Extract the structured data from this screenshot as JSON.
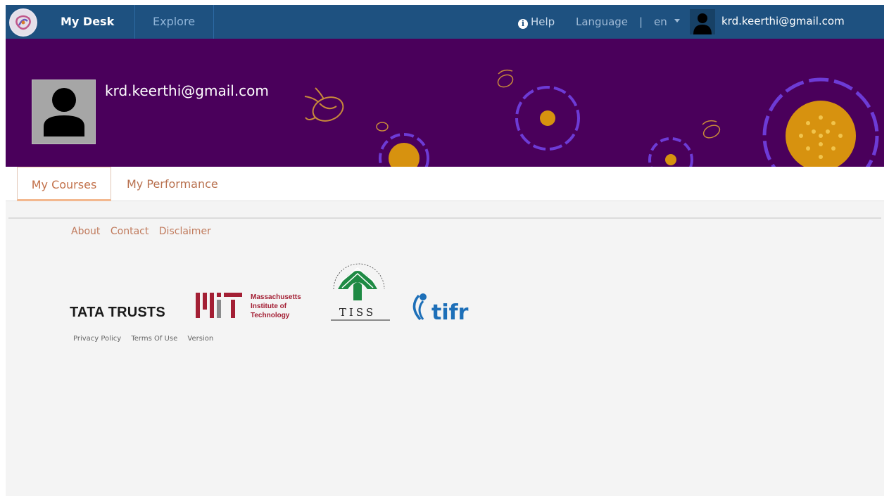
{
  "nav": {
    "my_desk": "My Desk",
    "explore": "Explore",
    "help": "Help",
    "help_icon": "info-icon",
    "language": "Language",
    "separator": "|",
    "language_value": "en",
    "user_email": "krd.keerthi@gmail.com"
  },
  "profile": {
    "name": "krd.keerthi@gmail.com"
  },
  "tabs": [
    {
      "label": "My Courses",
      "active": true
    },
    {
      "label": "My Performance",
      "active": false
    }
  ],
  "footer": {
    "links": [
      "About",
      "Contact",
      "Disclaimer"
    ],
    "partners": {
      "tata": "TATA TRUSTS",
      "mit_lines": [
        "Massachusetts",
        "Institute of",
        "Technology"
      ],
      "tiss": "TISS",
      "tifr": "tifr"
    },
    "small_links": [
      "Privacy Policy",
      "Terms Of Use",
      "Version"
    ]
  },
  "colors": {
    "navbar": "#1e5180",
    "banner": "#4a005b",
    "accent": "#c2714a",
    "mit_red": "#a31f34",
    "tifr_blue": "#1d6fb8",
    "tiss_green": "#1e8a44"
  }
}
